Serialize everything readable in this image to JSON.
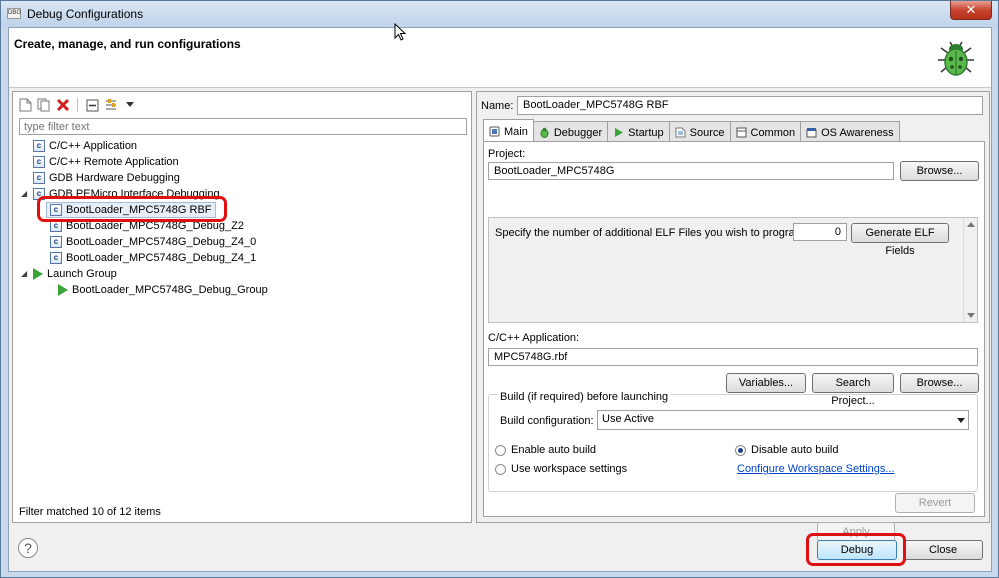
{
  "window": {
    "title": "Debug Configurations",
    "icon_text": "DBG",
    "close_glyph": "✕"
  },
  "banner": {
    "title": "Create, manage, and run configurations"
  },
  "left": {
    "filter_placeholder": "type filter text",
    "tree": [
      {
        "label": "C/C++ Application",
        "level": 1,
        "icon": "c-icon"
      },
      {
        "label": "C/C++ Remote Application",
        "level": 1,
        "icon": "c-icon"
      },
      {
        "label": "GDB Hardware Debugging",
        "level": 1,
        "icon": "c-icon"
      },
      {
        "label": "GDB PEMicro Interface Debugging",
        "level": 1,
        "icon": "c-icon",
        "expanded": true
      },
      {
        "label": "BootLoader_MPC5748G RBF",
        "level": 2,
        "icon": "c-icon",
        "selected": true
      },
      {
        "label": "BootLoader_MPC5748G_Debug_Z2",
        "level": 2,
        "icon": "c-icon"
      },
      {
        "label": "BootLoader_MPC5748G_Debug_Z4_0",
        "level": 2,
        "icon": "c-icon"
      },
      {
        "label": "BootLoader_MPC5748G_Debug_Z4_1",
        "level": 2,
        "icon": "c-icon"
      },
      {
        "label": "Launch Group",
        "level": 1,
        "icon": "play-icon",
        "expanded": true
      },
      {
        "label": "BootLoader_MPC5748G_Debug_Group",
        "level": 2,
        "icon": "play-icon"
      }
    ],
    "twisty_expanded": "◢",
    "filter_status": "Filter matched 10 of 12 items"
  },
  "right": {
    "name_label": "Name:",
    "name_value": "BootLoader_MPC5748G RBF",
    "tabs": [
      {
        "label": "Main",
        "active": true
      },
      {
        "label": "Debugger"
      },
      {
        "label": "Startup"
      },
      {
        "label": "Source"
      },
      {
        "label": "Common"
      },
      {
        "label": "OS Awareness"
      }
    ],
    "project_label": "Project:",
    "project_value": "BootLoader_MPC5748G",
    "browse_label": "Browse...",
    "elf_label": "Specify the number of additional ELF Files you wish to program:",
    "elf_count": "0",
    "generate_elf_label": "Generate ELF Fields",
    "app_label": "C/C++ Application:",
    "app_value": "MPC5748G.rbf",
    "variables_label": "Variables...",
    "search_project_label": "Search Project...",
    "browse2_label": "Browse...",
    "build_group_label": "Build (if required) before launching",
    "build_config_label": "Build configuration:",
    "build_config_value": "Use Active",
    "enable_auto_build": "Enable auto build",
    "disable_auto_build": "Disable auto build",
    "use_workspace_settings": "Use workspace settings",
    "configure_workspace_link": "Configure Workspace Settings...",
    "apply_label": "Apply",
    "revert_label": "Revert"
  },
  "footer": {
    "help_glyph": "?",
    "debug_label": "Debug",
    "close_label": "Close"
  },
  "colors": {
    "highlight": "#e01010",
    "link": "#0044cc",
    "titlebar": "#c9d8ea"
  }
}
